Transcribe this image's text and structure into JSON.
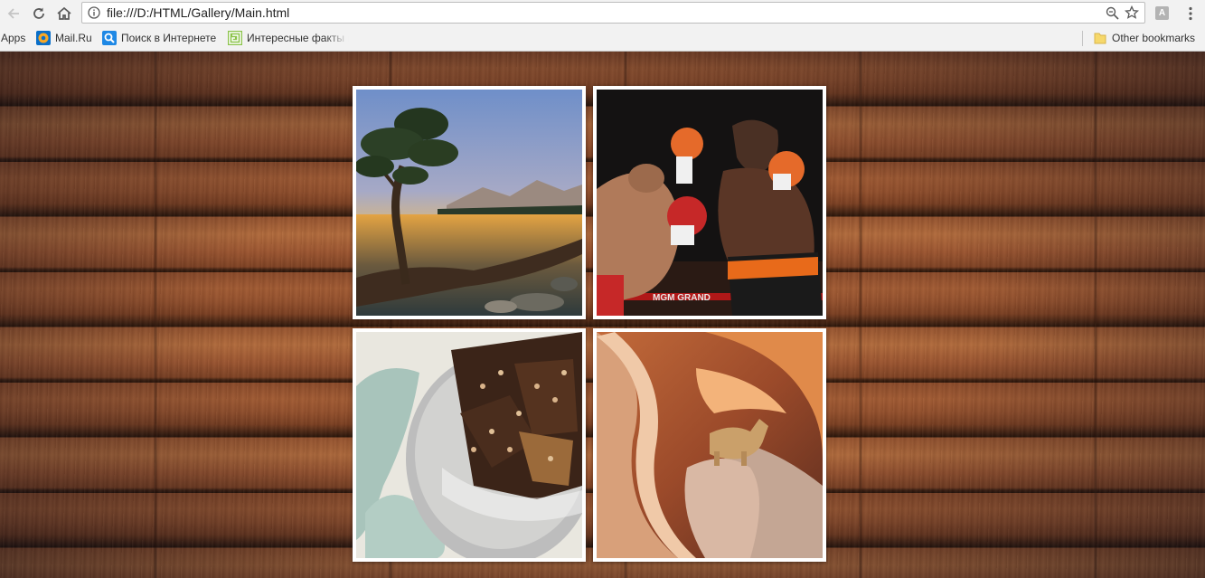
{
  "browser": {
    "url": "file:///D:/HTML/Gallery/Main.html",
    "extension_badge": "A",
    "icons": {
      "back": "back-arrow-icon",
      "reload": "reload-icon",
      "home": "home-icon",
      "info": "info-icon",
      "zoom": "zoom-icon",
      "bookmark_star": "star-icon",
      "menu": "kebab-menu-icon"
    }
  },
  "bookmarks": {
    "apps_label": "Apps",
    "items": [
      {
        "label": "Mail.Ru",
        "icon": "mailru-icon"
      },
      {
        "label": "Поиск в Интернете",
        "icon": "search-icon"
      },
      {
        "label": "Интересные факты п",
        "icon": "maze-icon"
      }
    ],
    "other_label": "Other bookmarks",
    "other_icon": "folder-icon"
  },
  "gallery": {
    "photos": [
      {
        "subject": "tree-at-lake-sunset"
      },
      {
        "subject": "boxing-match"
      },
      {
        "subject": "chocolate-bark-tin"
      },
      {
        "subject": "cougar-in-canyon"
      }
    ],
    "boxing_ring_text": "MGM GRAND"
  }
}
